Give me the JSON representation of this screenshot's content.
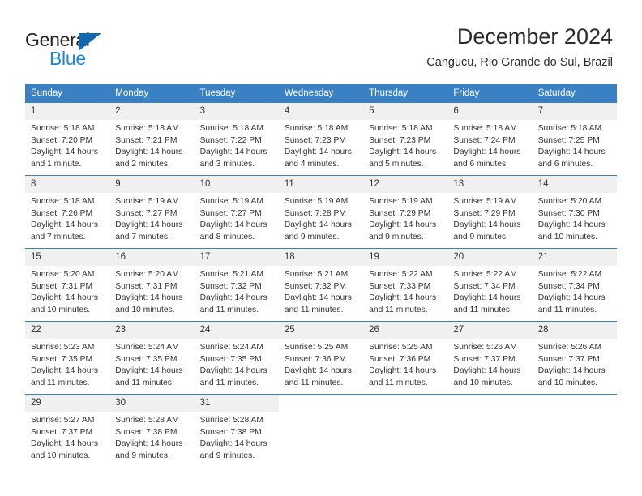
{
  "brand": {
    "name_part1": "General",
    "name_part2": "Blue",
    "triangle_color": "#1268b3",
    "blue_text_color": "#1a87dc"
  },
  "header": {
    "title": "December 2024",
    "subtitle": "Cangucu, Rio Grande do Sul, Brazil"
  },
  "theme": {
    "header_row_bg": "#3a81c4",
    "day_number_bg": "#f0f0f0",
    "grid_line": "#3a81c4",
    "text": "#333333"
  },
  "weekday_headers": [
    "Sunday",
    "Monday",
    "Tuesday",
    "Wednesday",
    "Thursday",
    "Friday",
    "Saturday"
  ],
  "weeks": [
    [
      {
        "day": "1",
        "sunrise": "Sunrise: 5:18 AM",
        "sunset": "Sunset: 7:20 PM",
        "daylight_line1": "Daylight: 14 hours",
        "daylight_line2": "and 1 minute."
      },
      {
        "day": "2",
        "sunrise": "Sunrise: 5:18 AM",
        "sunset": "Sunset: 7:21 PM",
        "daylight_line1": "Daylight: 14 hours",
        "daylight_line2": "and 2 minutes."
      },
      {
        "day": "3",
        "sunrise": "Sunrise: 5:18 AM",
        "sunset": "Sunset: 7:22 PM",
        "daylight_line1": "Daylight: 14 hours",
        "daylight_line2": "and 3 minutes."
      },
      {
        "day": "4",
        "sunrise": "Sunrise: 5:18 AM",
        "sunset": "Sunset: 7:23 PM",
        "daylight_line1": "Daylight: 14 hours",
        "daylight_line2": "and 4 minutes."
      },
      {
        "day": "5",
        "sunrise": "Sunrise: 5:18 AM",
        "sunset": "Sunset: 7:23 PM",
        "daylight_line1": "Daylight: 14 hours",
        "daylight_line2": "and 5 minutes."
      },
      {
        "day": "6",
        "sunrise": "Sunrise: 5:18 AM",
        "sunset": "Sunset: 7:24 PM",
        "daylight_line1": "Daylight: 14 hours",
        "daylight_line2": "and 6 minutes."
      },
      {
        "day": "7",
        "sunrise": "Sunrise: 5:18 AM",
        "sunset": "Sunset: 7:25 PM",
        "daylight_line1": "Daylight: 14 hours",
        "daylight_line2": "and 6 minutes."
      }
    ],
    [
      {
        "day": "8",
        "sunrise": "Sunrise: 5:18 AM",
        "sunset": "Sunset: 7:26 PM",
        "daylight_line1": "Daylight: 14 hours",
        "daylight_line2": "and 7 minutes."
      },
      {
        "day": "9",
        "sunrise": "Sunrise: 5:19 AM",
        "sunset": "Sunset: 7:27 PM",
        "daylight_line1": "Daylight: 14 hours",
        "daylight_line2": "and 7 minutes."
      },
      {
        "day": "10",
        "sunrise": "Sunrise: 5:19 AM",
        "sunset": "Sunset: 7:27 PM",
        "daylight_line1": "Daylight: 14 hours",
        "daylight_line2": "and 8 minutes."
      },
      {
        "day": "11",
        "sunrise": "Sunrise: 5:19 AM",
        "sunset": "Sunset: 7:28 PM",
        "daylight_line1": "Daylight: 14 hours",
        "daylight_line2": "and 9 minutes."
      },
      {
        "day": "12",
        "sunrise": "Sunrise: 5:19 AM",
        "sunset": "Sunset: 7:29 PM",
        "daylight_line1": "Daylight: 14 hours",
        "daylight_line2": "and 9 minutes."
      },
      {
        "day": "13",
        "sunrise": "Sunrise: 5:19 AM",
        "sunset": "Sunset: 7:29 PM",
        "daylight_line1": "Daylight: 14 hours",
        "daylight_line2": "and 9 minutes."
      },
      {
        "day": "14",
        "sunrise": "Sunrise: 5:20 AM",
        "sunset": "Sunset: 7:30 PM",
        "daylight_line1": "Daylight: 14 hours",
        "daylight_line2": "and 10 minutes."
      }
    ],
    [
      {
        "day": "15",
        "sunrise": "Sunrise: 5:20 AM",
        "sunset": "Sunset: 7:31 PM",
        "daylight_line1": "Daylight: 14 hours",
        "daylight_line2": "and 10 minutes."
      },
      {
        "day": "16",
        "sunrise": "Sunrise: 5:20 AM",
        "sunset": "Sunset: 7:31 PM",
        "daylight_line1": "Daylight: 14 hours",
        "daylight_line2": "and 10 minutes."
      },
      {
        "day": "17",
        "sunrise": "Sunrise: 5:21 AM",
        "sunset": "Sunset: 7:32 PM",
        "daylight_line1": "Daylight: 14 hours",
        "daylight_line2": "and 11 minutes."
      },
      {
        "day": "18",
        "sunrise": "Sunrise: 5:21 AM",
        "sunset": "Sunset: 7:32 PM",
        "daylight_line1": "Daylight: 14 hours",
        "daylight_line2": "and 11 minutes."
      },
      {
        "day": "19",
        "sunrise": "Sunrise: 5:22 AM",
        "sunset": "Sunset: 7:33 PM",
        "daylight_line1": "Daylight: 14 hours",
        "daylight_line2": "and 11 minutes."
      },
      {
        "day": "20",
        "sunrise": "Sunrise: 5:22 AM",
        "sunset": "Sunset: 7:34 PM",
        "daylight_line1": "Daylight: 14 hours",
        "daylight_line2": "and 11 minutes."
      },
      {
        "day": "21",
        "sunrise": "Sunrise: 5:22 AM",
        "sunset": "Sunset: 7:34 PM",
        "daylight_line1": "Daylight: 14 hours",
        "daylight_line2": "and 11 minutes."
      }
    ],
    [
      {
        "day": "22",
        "sunrise": "Sunrise: 5:23 AM",
        "sunset": "Sunset: 7:35 PM",
        "daylight_line1": "Daylight: 14 hours",
        "daylight_line2": "and 11 minutes."
      },
      {
        "day": "23",
        "sunrise": "Sunrise: 5:24 AM",
        "sunset": "Sunset: 7:35 PM",
        "daylight_line1": "Daylight: 14 hours",
        "daylight_line2": "and 11 minutes."
      },
      {
        "day": "24",
        "sunrise": "Sunrise: 5:24 AM",
        "sunset": "Sunset: 7:35 PM",
        "daylight_line1": "Daylight: 14 hours",
        "daylight_line2": "and 11 minutes."
      },
      {
        "day": "25",
        "sunrise": "Sunrise: 5:25 AM",
        "sunset": "Sunset: 7:36 PM",
        "daylight_line1": "Daylight: 14 hours",
        "daylight_line2": "and 11 minutes."
      },
      {
        "day": "26",
        "sunrise": "Sunrise: 5:25 AM",
        "sunset": "Sunset: 7:36 PM",
        "daylight_line1": "Daylight: 14 hours",
        "daylight_line2": "and 11 minutes."
      },
      {
        "day": "27",
        "sunrise": "Sunrise: 5:26 AM",
        "sunset": "Sunset: 7:37 PM",
        "daylight_line1": "Daylight: 14 hours",
        "daylight_line2": "and 10 minutes."
      },
      {
        "day": "28",
        "sunrise": "Sunrise: 5:26 AM",
        "sunset": "Sunset: 7:37 PM",
        "daylight_line1": "Daylight: 14 hours",
        "daylight_line2": "and 10 minutes."
      }
    ],
    [
      {
        "day": "29",
        "sunrise": "Sunrise: 5:27 AM",
        "sunset": "Sunset: 7:37 PM",
        "daylight_line1": "Daylight: 14 hours",
        "daylight_line2": "and 10 minutes."
      },
      {
        "day": "30",
        "sunrise": "Sunrise: 5:28 AM",
        "sunset": "Sunset: 7:38 PM",
        "daylight_line1": "Daylight: 14 hours",
        "daylight_line2": "and 9 minutes."
      },
      {
        "day": "31",
        "sunrise": "Sunrise: 5:28 AM",
        "sunset": "Sunset: 7:38 PM",
        "daylight_line1": "Daylight: 14 hours",
        "daylight_line2": "and 9 minutes."
      },
      {
        "day": "",
        "sunrise": "",
        "sunset": "",
        "daylight_line1": "",
        "daylight_line2": ""
      },
      {
        "day": "",
        "sunrise": "",
        "sunset": "",
        "daylight_line1": "",
        "daylight_line2": ""
      },
      {
        "day": "",
        "sunrise": "",
        "sunset": "",
        "daylight_line1": "",
        "daylight_line2": ""
      },
      {
        "day": "",
        "sunrise": "",
        "sunset": "",
        "daylight_line1": "",
        "daylight_line2": ""
      }
    ]
  ]
}
